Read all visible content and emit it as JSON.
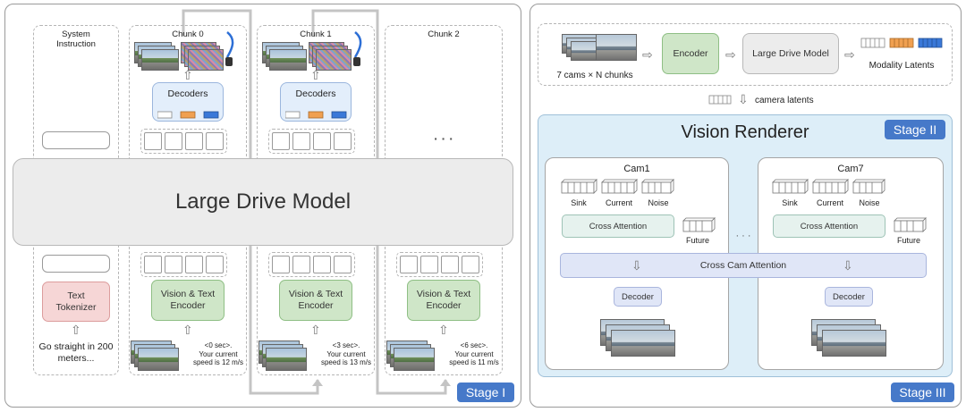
{
  "stage1": {
    "label": "Stage I",
    "system_instruction": "System\nInstruction",
    "chunks": [
      "Chunk  0",
      "Chunk  1",
      "Chunk  2"
    ],
    "decoders": "Decoders",
    "ellipsis": "· · ·",
    "large_drive_model": "Large Drive Model",
    "text_tokenizer": "Text\nTokenizer",
    "vision_text_encoder": "Vision & Text\nEncoder",
    "instruction_text": "Go straight in 200\nmeters...",
    "speed_0": "<0 sec>.\nYour current\nspeed is 12 m/s",
    "speed_1": "<3 sec>.\nYour current\nspeed is 13 m/s",
    "speed_2": "<6 sec>.\nYour current\nspeed is 11 m/s"
  },
  "stage2": {
    "label": "Stage II",
    "input_caption": "7 cams × N chunks",
    "encoder": "Encoder",
    "large_drive_model": "Large Drive Model",
    "modality_latents": "Modality Latents",
    "camera_latents": "camera latents",
    "vision_renderer": "Vision Renderer",
    "cams": [
      {
        "title": "Cam1",
        "sink": "Sink",
        "current": "Current",
        "noise": "Noise",
        "future": "Future",
        "cross_attention": "Cross Attention",
        "decoder": "Decoder"
      },
      {
        "title": "Cam7",
        "sink": "Sink",
        "current": "Current",
        "noise": "Noise",
        "future": "Future",
        "cross_attention": "Cross Attention",
        "decoder": "Decoder"
      }
    ],
    "cams_ellipsis": "· · ·",
    "cross_cam_attention": "Cross Cam Attention"
  },
  "stage3": {
    "label": "Stage III"
  },
  "colors": {
    "stage_badge": "#4679c9",
    "encoder_green": "#cfe6c8",
    "tokenizer_pink": "#f6d6d6",
    "decoder_blue": "#e3eefb",
    "renderer_bg": "#ddeef8",
    "latent_orange": "#f0a050",
    "latent_blue": "#3a78d8"
  }
}
